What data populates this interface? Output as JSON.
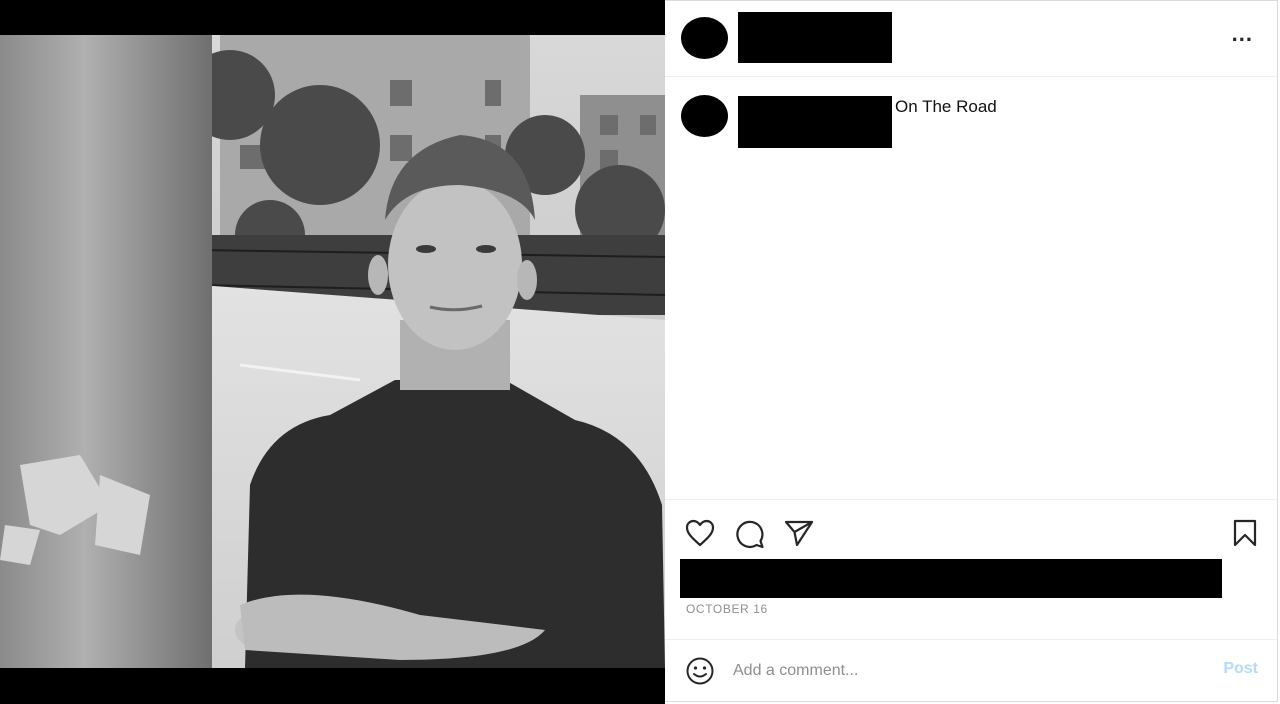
{
  "post": {
    "caption": "On The Road",
    "date": "OCTOBER 16"
  },
  "header": {
    "more_label": "..."
  },
  "comment": {
    "placeholder": "Add a comment...",
    "post_label": "Post"
  },
  "icons": {
    "more": "more-options-icon",
    "like": "heart-icon",
    "comment": "comment-bubble-icon",
    "share": "paper-plane-icon",
    "save": "bookmark-icon",
    "emoji": "emoji-smiley-icon"
  },
  "colors": {
    "border": "#dbdbdb",
    "muted_text": "#8e8e8e",
    "post_button_disabled": "#b3dbff"
  }
}
